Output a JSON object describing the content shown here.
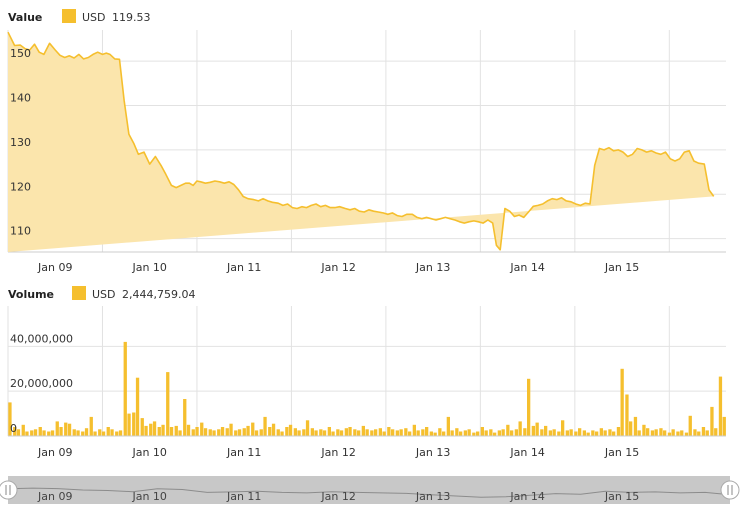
{
  "colors": {
    "series": "#f5bf2e",
    "area_fill": "#fbe5ac",
    "grid": "#e2e2e2",
    "navigator_bg": "#d4d4d4",
    "navigator_mask": "#b0b0b0"
  },
  "chart_data": [
    {
      "type": "area",
      "title": "Value",
      "legend": {
        "name": "USD",
        "value": "119.53",
        "placement": "top-left"
      },
      "ylim": [
        107,
        157
      ],
      "y_ticks": [
        "110",
        "120",
        "130",
        "140",
        "150"
      ],
      "x_ticks": [
        "Jan 09",
        "Jan 10",
        "Jan 11",
        "Jan 12",
        "Jan 13",
        "Jan 14",
        "Jan 15"
      ],
      "grid": true,
      "x": [
        8.0,
        8.07,
        8.13,
        8.18,
        8.23,
        8.28,
        8.33,
        8.38,
        8.44,
        8.5,
        8.55,
        8.6,
        8.65,
        8.7,
        8.75,
        8.8,
        8.85,
        8.9,
        8.95,
        9.0,
        9.04,
        9.08,
        9.13,
        9.18,
        9.23,
        9.28,
        9.33,
        9.38,
        9.44,
        9.5,
        9.56,
        9.62,
        9.67,
        9.73,
        9.78,
        9.83,
        9.88,
        9.92,
        9.96,
        10.0,
        10.04,
        10.09,
        10.14,
        10.19,
        10.24,
        10.29,
        10.34,
        10.39,
        10.44,
        10.49,
        10.54,
        10.6,
        10.65,
        10.7,
        10.75,
        10.8,
        10.86,
        10.91,
        10.96,
        11.01,
        11.06,
        11.11,
        11.16,
        11.21,
        11.26,
        11.31,
        11.36,
        11.41,
        11.46,
        11.51,
        11.57,
        11.62,
        11.67,
        11.72,
        11.77,
        11.82,
        11.87,
        11.92,
        11.97,
        12.02,
        12.07,
        12.12,
        12.17,
        12.22,
        12.28,
        12.33,
        12.38,
        12.43,
        12.48,
        12.53,
        12.58,
        12.63,
        12.68,
        12.73,
        12.78,
        12.83,
        12.88,
        12.93,
        12.98,
        13.03,
        13.08,
        13.13,
        13.17,
        13.21,
        13.26,
        13.31,
        13.36,
        13.41,
        13.46,
        13.51,
        13.56,
        13.61,
        13.66,
        13.71,
        13.76,
        13.81,
        13.86,
        13.91,
        13.96,
        14.01,
        14.06,
        14.11,
        14.16,
        14.21,
        14.26,
        14.31,
        14.36,
        14.41,
        14.46,
        14.51,
        14.56,
        14.61,
        14.66,
        14.71,
        14.76,
        14.81,
        14.86,
        14.91,
        14.96,
        15.01,
        15.06,
        15.11,
        15.16,
        15.21,
        15.26,
        15.31,
        15.37,
        15.42,
        15.47,
        15.52,
        15.57
      ],
      "values": [
        156.5,
        153.5,
        153.6,
        152.8,
        152.5,
        153.8,
        152.0,
        151.5,
        154.0,
        152.5,
        151.3,
        150.8,
        151.2,
        150.7,
        151.5,
        150.5,
        150.8,
        151.5,
        152.0,
        151.5,
        151.8,
        151.5,
        150.5,
        150.4,
        141.0,
        133.5,
        131.5,
        129.0,
        129.5,
        126.8,
        128.5,
        126.5,
        124.5,
        122.0,
        121.5,
        122.0,
        122.5,
        122.5,
        122.0,
        123.0,
        122.8,
        122.5,
        122.7,
        123.0,
        122.8,
        122.5,
        122.8,
        122.2,
        121.0,
        119.5,
        119.0,
        118.8,
        118.5,
        119.0,
        118.5,
        118.2,
        118.0,
        117.5,
        117.8,
        117.0,
        116.8,
        117.2,
        117.0,
        117.5,
        117.8,
        117.2,
        117.5,
        117.0,
        117.0,
        117.2,
        116.8,
        116.5,
        116.8,
        116.2,
        116.0,
        116.5,
        116.2,
        116.0,
        115.8,
        115.5,
        115.8,
        115.2,
        115.0,
        115.5,
        115.5,
        114.8,
        114.5,
        114.8,
        114.5,
        114.2,
        114.5,
        114.8,
        114.5,
        114.2,
        113.8,
        113.5,
        113.8,
        114.0,
        113.8,
        113.5,
        114.2,
        113.5,
        108.5,
        107.5,
        116.8,
        116.2,
        115.0,
        115.3,
        114.8,
        116.0,
        117.3,
        117.5,
        117.8,
        118.5,
        119.0,
        118.8,
        119.2,
        118.5,
        118.3,
        117.8,
        117.5,
        118.0,
        117.8,
        126.5,
        130.3,
        130.0,
        130.5,
        129.8,
        130.0,
        129.5,
        128.5,
        129.0,
        130.3,
        130.0,
        129.5,
        129.8,
        129.3,
        129.0,
        129.5,
        128.0,
        127.5,
        128.0,
        129.5,
        129.8,
        127.5,
        127.0,
        126.8,
        121.0,
        119.53
      ]
    },
    {
      "type": "bar",
      "title": "Volume",
      "legend": {
        "name": "USD",
        "value": "2,444,759.04",
        "placement": "top-left"
      },
      "ylim": [
        0,
        58000000
      ],
      "y_ticks": [
        "0",
        "20,000,000",
        "40,000,000"
      ],
      "x_ticks": [
        "Jan 09",
        "Jan 10",
        "Jan 11",
        "Jan 12",
        "Jan 13",
        "Jan 14",
        "Jan 15"
      ],
      "grid": true,
      "x": [
        8.0,
        8.05,
        8.09,
        8.14,
        8.18,
        8.23,
        8.27,
        8.32,
        8.36,
        8.41,
        8.45,
        8.5,
        8.54,
        8.59,
        8.63,
        8.68,
        8.72,
        8.77,
        8.81,
        8.86,
        8.9,
        8.95,
        8.99,
        9.04,
        9.08,
        9.13,
        9.17,
        9.22,
        9.26,
        9.31,
        9.35,
        9.4,
        9.44,
        9.49,
        9.53,
        9.58,
        9.62,
        9.67,
        9.71,
        9.76,
        9.8,
        9.85,
        9.89,
        9.94,
        9.98,
        10.03,
        10.07,
        10.12,
        10.16,
        10.21,
        10.25,
        10.3,
        10.34,
        10.39,
        10.43,
        10.48,
        10.52,
        10.57,
        10.61,
        10.66,
        10.7,
        10.75,
        10.79,
        10.84,
        10.88,
        10.93,
        10.97,
        11.02,
        11.06,
        11.11,
        11.15,
        11.2,
        11.24,
        11.29,
        11.33,
        11.38,
        11.42,
        11.47,
        11.51,
        11.56,
        11.6,
        11.65,
        11.69,
        11.74,
        11.78,
        11.83,
        11.87,
        11.92,
        11.96,
        12.01,
        12.05,
        12.1,
        12.14,
        12.19,
        12.23,
        12.28,
        12.32,
        12.37,
        12.41,
        12.46,
        12.5,
        12.55,
        12.59,
        12.64,
        12.68,
        12.73,
        12.77,
        12.82,
        12.86,
        12.91,
        12.95,
        13.0,
        13.04,
        13.09,
        13.13,
        13.18,
        13.22,
        13.27,
        13.31,
        13.36,
        13.4,
        13.45,
        13.49,
        13.54,
        13.58,
        13.63,
        13.67,
        13.72,
        13.76,
        13.81,
        13.85,
        13.9,
        13.94,
        13.99,
        14.03,
        14.08,
        14.12,
        14.17,
        14.21,
        14.26,
        14.3,
        14.35,
        14.39,
        14.44,
        14.48,
        14.53,
        14.57,
        14.62,
        14.66,
        14.71,
        14.75,
        14.8,
        14.84,
        14.89,
        14.93,
        14.98,
        15.02,
        15.07,
        15.11,
        15.16,
        15.2,
        15.25,
        15.29,
        15.34,
        15.38,
        15.43,
        15.47,
        15.52,
        15.56
      ],
      "values": [
        15000000,
        4000000,
        3000000,
        5000000,
        2000000,
        2500000,
        3000000,
        4000000,
        2500000,
        2000000,
        2500000,
        6500000,
        4000000,
        6000000,
        5500000,
        3000000,
        2500000,
        2000000,
        3500000,
        8500000,
        2000000,
        3000000,
        2000000,
        4000000,
        3000000,
        2000000,
        2500000,
        42000000,
        10000000,
        10500000,
        26000000,
        8000000,
        4500000,
        5500000,
        6500000,
        4000000,
        5000000,
        28500000,
        4000000,
        4500000,
        2500000,
        16500000,
        5000000,
        3000000,
        4000000,
        6000000,
        3500000,
        3000000,
        2500000,
        3000000,
        4000000,
        3500000,
        5500000,
        2500000,
        3000000,
        3500000,
        4500000,
        6000000,
        2500000,
        3000000,
        8500000,
        4000000,
        5500000,
        3000000,
        2000000,
        4000000,
        5000000,
        3500000,
        2500000,
        3000000,
        7000000,
        3500000,
        2500000,
        3000000,
        2500000,
        4000000,
        2000000,
        3000000,
        2500000,
        3500000,
        4000000,
        3000000,
        2500000,
        4500000,
        3000000,
        2500000,
        3000000,
        3500000,
        2000000,
        4000000,
        3000000,
        2500000,
        3000000,
        3500000,
        2000000,
        5000000,
        2500000,
        3000000,
        4000000,
        2000000,
        1500000,
        3500000,
        2000000,
        8500000,
        2500000,
        3500000,
        2000000,
        2500000,
        3000000,
        1500000,
        2000000,
        4000000,
        2500000,
        3000000,
        1500000,
        2500000,
        3000000,
        5000000,
        2500000,
        3000000,
        6500000,
        3500000,
        25500000,
        4500000,
        6000000,
        3000000,
        4500000,
        2500000,
        3000000,
        2000000,
        7000000,
        2500000,
        3000000,
        2000000,
        3500000,
        2500000,
        1500000,
        2500000,
        2000000,
        3500000,
        2500000,
        3000000,
        2000000,
        4000000,
        30000000,
        18500000,
        6500000,
        8500000,
        2500000,
        5000000,
        3500000,
        2500000,
        3000000,
        3500000,
        2500000,
        1500000,
        3000000,
        2000000,
        2500000,
        1500000,
        9000000,
        3000000,
        2000000,
        4000000,
        2500000,
        13000000,
        3500000,
        26500000,
        8500000
      ]
    }
  ],
  "navigator": {
    "x_ticks": [
      "Jan 09",
      "Jan 10",
      "Jan 11",
      "Jan 12",
      "Jan 13",
      "Jan 14",
      "Jan 15"
    ],
    "values": [
      0.55,
      0.58,
      0.56,
      0.5,
      0.48,
      0.43,
      0.55,
      0.52,
      0.4,
      0.42,
      0.45,
      0.4,
      0.38,
      0.43,
      0.4,
      0.38,
      0.36,
      0.3,
      0.25,
      0.2,
      0.22,
      0.28,
      0.35,
      0.32,
      0.45,
      0.4,
      0.42,
      0.38,
      0.4,
      0.3
    ]
  }
}
